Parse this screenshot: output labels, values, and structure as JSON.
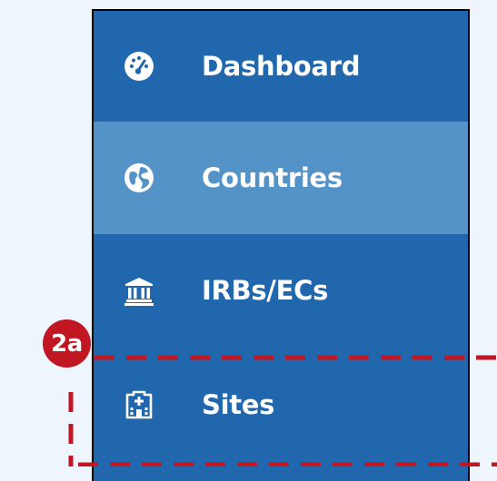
{
  "sidebar": {
    "items": [
      {
        "label": "Dashboard",
        "icon": "dashboard-gauge-icon",
        "active": false
      },
      {
        "label": "Countries",
        "icon": "globe-icon",
        "active": true
      },
      {
        "label": "IRBs/ECs",
        "icon": "institution-icon",
        "active": false
      },
      {
        "label": "Sites",
        "icon": "hospital-icon",
        "active": false
      }
    ]
  },
  "annotation": {
    "badge_label": "2a",
    "color": "#c01722"
  },
  "colors": {
    "sidebar_bg": "#2067ad",
    "active_item_bg": "#5393c8",
    "page_bg": "#eef5fc"
  }
}
